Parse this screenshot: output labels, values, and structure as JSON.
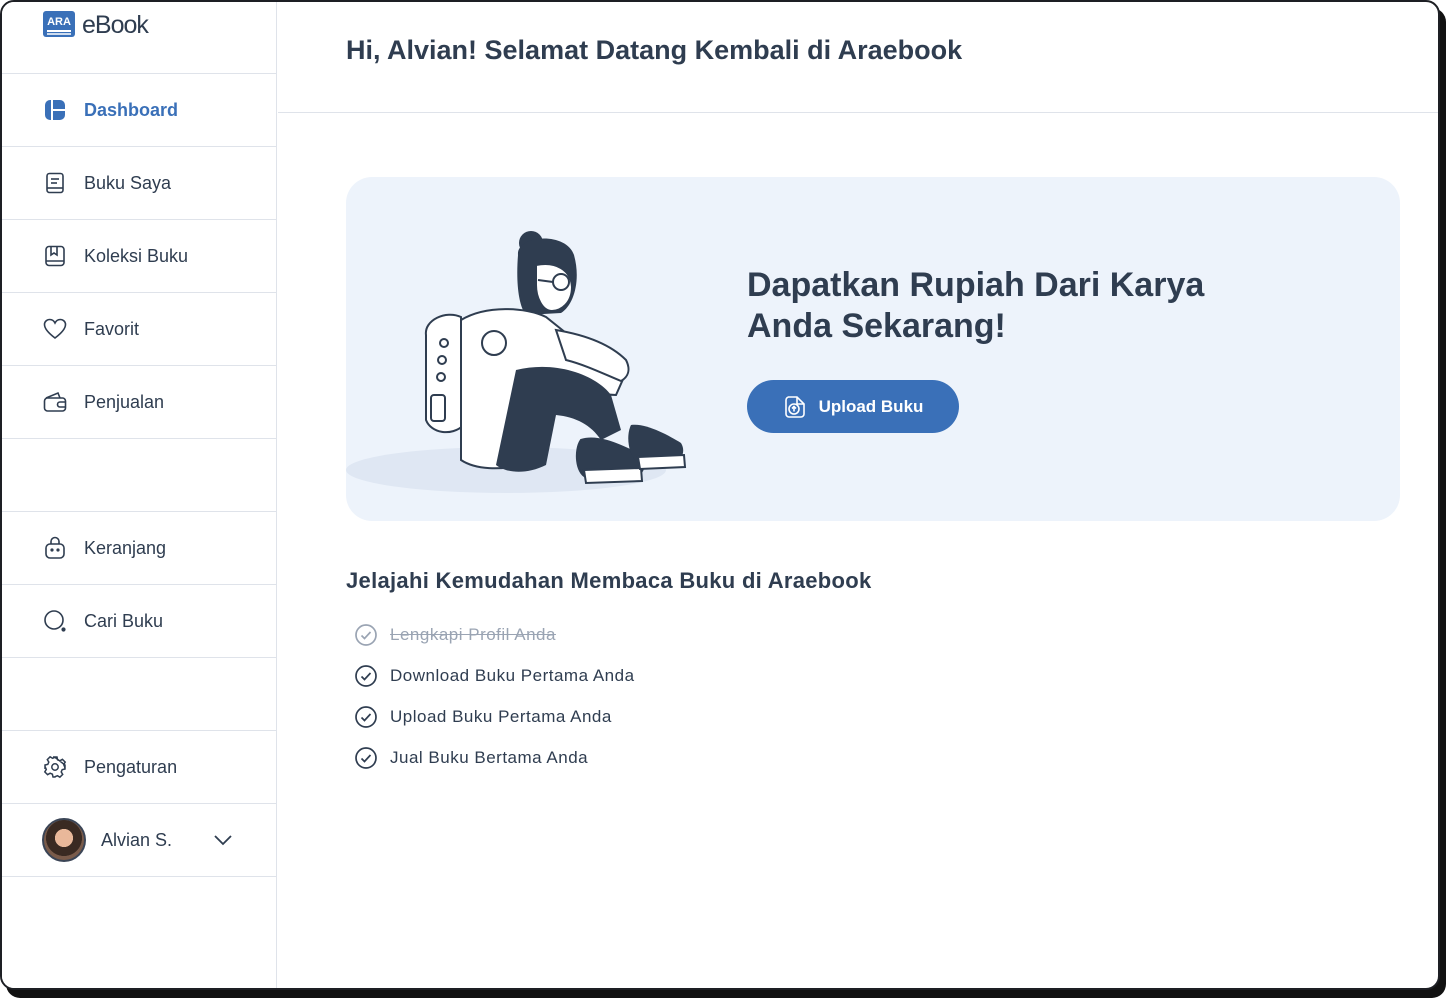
{
  "app": {
    "logo_mark": "ARA",
    "logo_text": "eBook",
    "accent_color": "#3a70b8",
    "text_color": "#2f3d50"
  },
  "sidebar": {
    "items": [
      {
        "label": "Dashboard",
        "icon": "dashboard-icon",
        "active": true
      },
      {
        "label": "Buku Saya",
        "icon": "book-icon",
        "active": false
      },
      {
        "label": "Koleksi Buku",
        "icon": "bookmark-book-icon",
        "active": false
      },
      {
        "label": "Favorit",
        "icon": "heart-icon",
        "active": false
      },
      {
        "label": "Penjualan",
        "icon": "wallet-icon",
        "active": false
      }
    ],
    "items2": [
      {
        "label": "Keranjang",
        "icon": "shopping-bag-icon"
      },
      {
        "label": "Cari Buku",
        "icon": "search-icon"
      }
    ],
    "settings": {
      "label": "Pengaturan",
      "icon": "gear-icon"
    },
    "user": {
      "name": "Alvian S.",
      "icon": "chevron-down-icon"
    }
  },
  "header": {
    "title": "Hi, Alvian! Selamat Datang Kembali di Araebook"
  },
  "banner": {
    "title": "Dapatkan Rupiah Dari Karya Anda Sekarang!",
    "button_label": "Upload Buku",
    "button_icon": "upload-file-icon",
    "illustration": "girl-sitting-with-backpack"
  },
  "explore": {
    "title": "Jelajahi Kemudahan Membaca Buku di Araebook",
    "items": [
      {
        "label": "Lengkapi Profil Anda",
        "done": true
      },
      {
        "label": "Download Buku Pertama Anda",
        "done": false
      },
      {
        "label": "Upload Buku Pertama Anda",
        "done": false
      },
      {
        "label": "Jual Buku Bertama Anda",
        "done": false
      }
    ]
  }
}
